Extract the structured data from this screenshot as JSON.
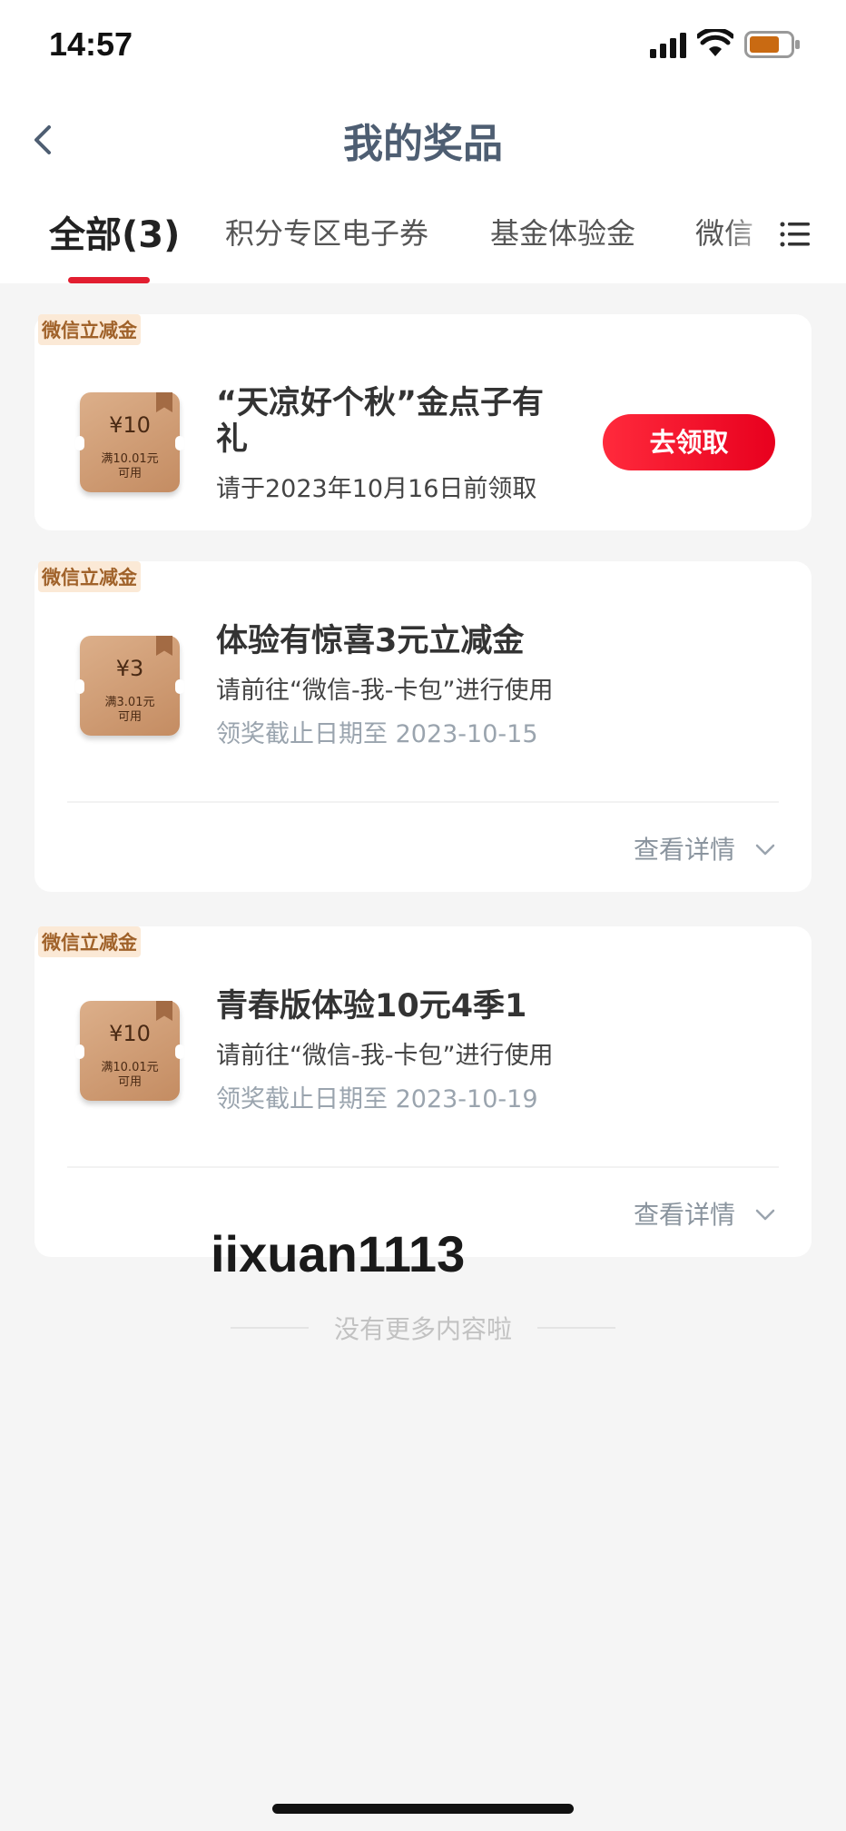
{
  "status_bar": {
    "time": "14:57"
  },
  "header": {
    "title": "我的奖品"
  },
  "tabs": [
    {
      "label": "全部(3)",
      "active": true
    },
    {
      "label": "积分专区电子券"
    },
    {
      "label": "基金体验金"
    },
    {
      "label": "微信"
    }
  ],
  "prizes": [
    {
      "category": "微信立减金",
      "coupon_amount": "¥10",
      "coupon_condition_1": "满10.01元",
      "coupon_condition_2": "可用",
      "title_line1": "“天凉好个秋”金点子有",
      "title_line2": "礼",
      "description": "请于2023年10月16日前领取",
      "action_label": "去领取"
    },
    {
      "category": "微信立减金",
      "coupon_amount": "¥3",
      "coupon_condition_1": "满3.01元",
      "coupon_condition_2": "可用",
      "title_line1": "体验有惊喜3元立减金",
      "description": "请前往“微信-我-卡包”进行使用",
      "deadline": "领奖截止日期至 2023-10-15",
      "detail_label": "查看详情"
    },
    {
      "category": "微信立减金",
      "coupon_amount": "¥10",
      "coupon_condition_1": "满10.01元",
      "coupon_condition_2": "可用",
      "title_line1": "青春版体验10元4季1",
      "description": "请前往“微信-我-卡包”进行使用",
      "deadline": "领奖截止日期至 2023-10-19",
      "detail_label": "查看详情"
    }
  ],
  "watermark": "iixuan1113",
  "end_text": "没有更多内容啦",
  "colors": {
    "accent": "#e21e30",
    "title": "#4e5e72",
    "category": "#a0622a"
  }
}
